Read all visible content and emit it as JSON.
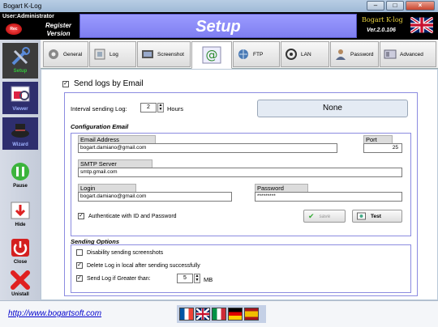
{
  "window": {
    "title": "Bogart K-Log"
  },
  "topbar": {
    "user": "User:Administrator",
    "rec_label": "Rec",
    "register_line1": "Register",
    "register_line2": "Version",
    "banner_title": "Setup",
    "brand_name": "Bogart K-log",
    "brand_version": "Ver.2.0.106"
  },
  "sidebar": {
    "items": [
      {
        "label": "Setup",
        "icon": "tools-icon"
      },
      {
        "label": "Viewer",
        "icon": "viewer-icon"
      },
      {
        "label": "Wizard",
        "icon": "wizard-icon"
      },
      {
        "label": "Pause",
        "icon": "pause-icon"
      },
      {
        "label": "Hide",
        "icon": "hide-icon"
      },
      {
        "label": "Close",
        "icon": "power-icon"
      },
      {
        "label": "Unistall",
        "icon": "x-icon"
      }
    ]
  },
  "tabs": [
    {
      "label": "General"
    },
    {
      "label": "Log"
    },
    {
      "label": "Screenshot"
    },
    {
      "label": ""
    },
    {
      "label": "FTP"
    },
    {
      "label": "LAN"
    },
    {
      "label": "Password"
    },
    {
      "label": "Advanced"
    }
  ],
  "email": {
    "send_logs_label": "Send logs by Email",
    "interval_label": "Interval sending Log:",
    "interval_value": "2",
    "interval_unit": "Hours",
    "status_box": "None",
    "config_title": "Configuration Email",
    "email_address_label": "Email Address",
    "email_address_value": "bogart.damiano@gmail.com",
    "port_label": "Port",
    "port_value": "25",
    "smtp_label": "SMTP Server",
    "smtp_value": "smtp.gmail.com",
    "login_label": "Login",
    "login_value": "bogart.damiano@gmail.com",
    "password_label": "Password",
    "password_value": "*********",
    "auth_label": "Authenticate with ID and Password",
    "save_label": "save",
    "test_label": "Test"
  },
  "sending_options": {
    "title": "Sending Options",
    "opt1": "Disability sending screenshots",
    "opt2": "Delete Log in local after sending successfully",
    "opt3": "Send Log if Greater than:",
    "size_value": "5",
    "size_unit": "MB"
  },
  "footer": {
    "url": "http://www.bogartsoft.com"
  },
  "colors": {
    "banner": "#8080f0",
    "accent_green": "#34c43c",
    "brand_yellow": "#e8d240"
  }
}
